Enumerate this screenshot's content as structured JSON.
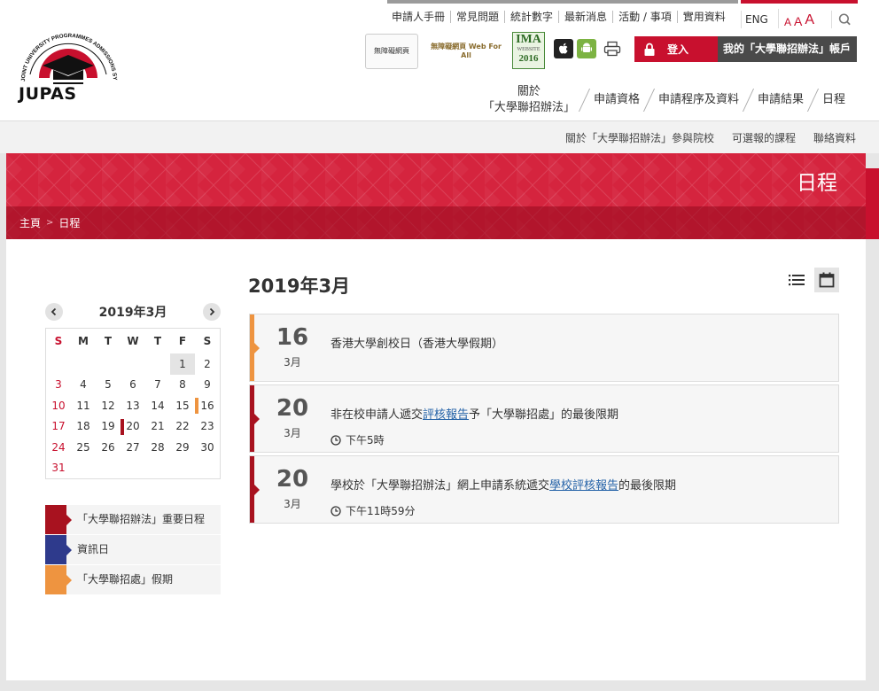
{
  "header": {
    "logo_text": "JUPAS",
    "logo_arc_text": "JOINT UNIVERSITY PROGRAMMES ADMISSIONS SYSTEM",
    "top_links": [
      "申請人手冊",
      "常見問題",
      "統計數字",
      "最新消息",
      "活動 / 事項",
      "實用資料"
    ],
    "lang": "ENG",
    "font_sizes": [
      "A",
      "A",
      "A"
    ],
    "badges": {
      "accessible_site": "無障礙網頁",
      "web_for_all": "無障礙網頁 Web For All",
      "ima_top": "IMA",
      "ima_mid": "WEBSITE",
      "ima_year": "2016"
    },
    "login_label": "登入",
    "account_label": "我的「大學聯招辦法」帳戶",
    "main_nav": [
      {
        "line1": "關於",
        "line2": "「大學聯招辦法」"
      },
      {
        "line1": "申請資格",
        "line2": ""
      },
      {
        "line1": "申請程序及資料",
        "line2": ""
      },
      {
        "line1": "申請結果",
        "line2": ""
      },
      {
        "line1": "日程",
        "line2": ""
      }
    ]
  },
  "subnav": [
    "關於「大學聯招辦法」參與院校",
    "可選報的課程",
    "聯絡資料"
  ],
  "banner": {
    "title": "日程",
    "breadcrumb": [
      "主頁",
      "日程"
    ]
  },
  "mini_calendar": {
    "title": "2019年3月",
    "weekdays": [
      "S",
      "M",
      "T",
      "W",
      "T",
      "F",
      "S"
    ],
    "weeks": [
      [
        "",
        "",
        "",
        "",
        "",
        "1",
        "2"
      ],
      [
        "3",
        "4",
        "5",
        "6",
        "7",
        "8",
        "9"
      ],
      [
        "10",
        "11",
        "12",
        "13",
        "14",
        "15",
        "16"
      ],
      [
        "17",
        "18",
        "19",
        "20",
        "21",
        "22",
        "23"
      ],
      [
        "24",
        "25",
        "26",
        "27",
        "28",
        "29",
        "30"
      ],
      [
        "31",
        "",
        "",
        "",
        "",
        "",
        ""
      ]
    ]
  },
  "legend": [
    {
      "label": "「大學聯招辦法」重要日程",
      "color": "#a8121f"
    },
    {
      "label": "資訊日",
      "color": "#2e3a8c"
    },
    {
      "label": "「大學聯招處」假期",
      "color": "#ee9440"
    }
  ],
  "events_section": {
    "month_title": "2019年3月",
    "events": [
      {
        "day": "16",
        "month": "3月",
        "color": "#ee9440",
        "pre": "香港大學創校日（香港大學假期）",
        "link": "",
        "post": "",
        "time": ""
      },
      {
        "day": "20",
        "month": "3月",
        "color": "#a8121f",
        "pre": "非在校申請人遞交",
        "link": "評核報告",
        "post": "予「大學聯招處」的最後限期",
        "time": "下午5時"
      },
      {
        "day": "20",
        "month": "3月",
        "color": "#a8121f",
        "pre": "學校於「大學聯招辦法」網上申請系統遞交",
        "link": "學校評核報告",
        "post": "的最後限期",
        "time": "下午11時59分"
      }
    ]
  }
}
